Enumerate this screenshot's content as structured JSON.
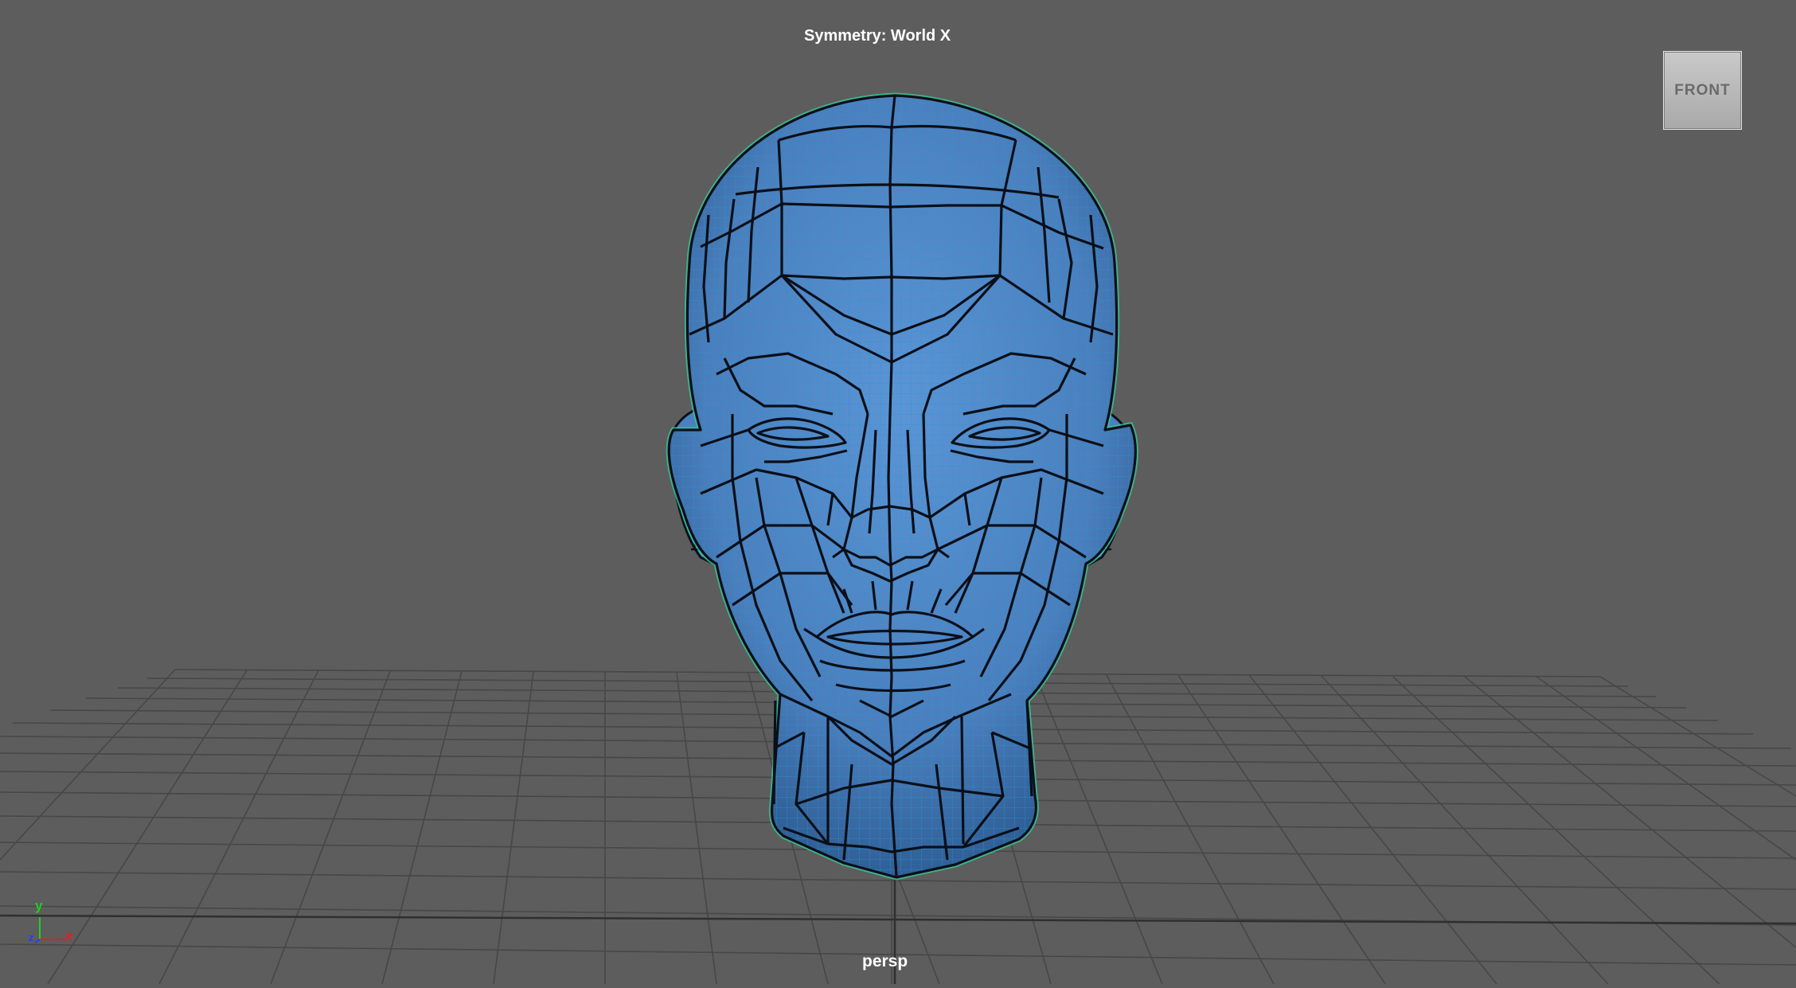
{
  "viewport": {
    "symmetry_label": "Symmetry: World X",
    "camera_label": "persp",
    "view_cube_face": "FRONT",
    "axes": {
      "y": "y",
      "z": "z",
      "x": "x"
    },
    "colors": {
      "background": "#5d5d5d",
      "grid": "#4a4a4a",
      "mesh_fill": "#4b7fbf",
      "mesh_wire": "#0a0f18",
      "smooth_wire": "#2a9ad6",
      "selection_outline": "#38c89a",
      "axis_x": "#e02020",
      "axis_y": "#20d020",
      "axis_z": "#2040f0"
    },
    "object": "head-mesh"
  }
}
